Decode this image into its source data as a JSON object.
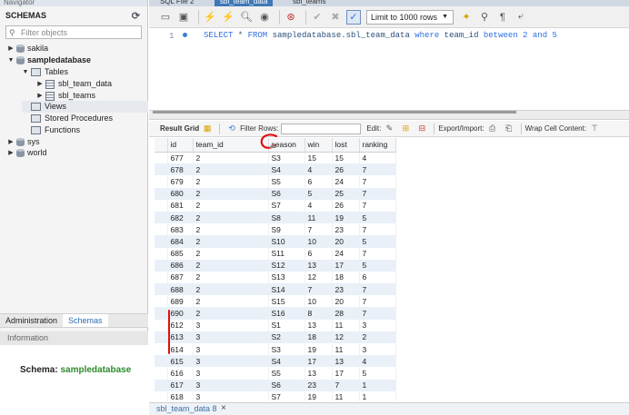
{
  "navigator": {
    "title": "Navigator",
    "schemas_header": "SCHEMAS",
    "filter_placeholder": "Filter objects",
    "tree": {
      "sakila": "sakila",
      "sampledatabase": "sampledatabase",
      "tables": "Tables",
      "table1": "sbl_team_data",
      "table2": "sbl_teams",
      "views": "Views",
      "stored_procedures": "Stored Procedures",
      "functions": "Functions",
      "sys": "sys",
      "world": "world"
    },
    "tabs": {
      "administration": "Administration",
      "schemas": "Schemas"
    },
    "information": "Information",
    "schema_label": "Schema:",
    "schema_value": "sampledatabase"
  },
  "tabstrip": [
    "SQL File 2",
    "sbl_team_data",
    "sbl_teams"
  ],
  "toolbar": {
    "limit": "Limit to 1000 rows"
  },
  "editor": {
    "line": "1",
    "sql": {
      "select": "SELECT",
      "star": " * ",
      "from": "FROM",
      "table": " sampledatabase.sbl_team_data ",
      "where": "where",
      "col": " team_id ",
      "between": "between",
      "a": " 2 ",
      "and": "and",
      "b": " 5"
    }
  },
  "result_toolbar": {
    "result_grid": "Result Grid",
    "filter_rows": "Filter Rows:",
    "edit": "Edit:",
    "export_import": "Export/Import:",
    "wrap": "Wrap Cell Content:"
  },
  "grid": {
    "columns": [
      "id",
      "team_id",
      "season",
      "win",
      "lost",
      "ranking"
    ],
    "rows": [
      [
        "677",
        "2",
        "S3",
        "15",
        "15",
        "4"
      ],
      [
        "678",
        "2",
        "S4",
        "4",
        "26",
        "7"
      ],
      [
        "679",
        "2",
        "S5",
        "6",
        "24",
        "7"
      ],
      [
        "680",
        "2",
        "S6",
        "5",
        "25",
        "7"
      ],
      [
        "681",
        "2",
        "S7",
        "4",
        "26",
        "7"
      ],
      [
        "682",
        "2",
        "S8",
        "11",
        "19",
        "5"
      ],
      [
        "683",
        "2",
        "S9",
        "7",
        "23",
        "7"
      ],
      [
        "684",
        "2",
        "S10",
        "10",
        "20",
        "5"
      ],
      [
        "685",
        "2",
        "S11",
        "6",
        "24",
        "7"
      ],
      [
        "686",
        "2",
        "S12",
        "13",
        "17",
        "5"
      ],
      [
        "687",
        "2",
        "S13",
        "12",
        "18",
        "6"
      ],
      [
        "688",
        "2",
        "S14",
        "7",
        "23",
        "7"
      ],
      [
        "689",
        "2",
        "S15",
        "10",
        "20",
        "7"
      ],
      [
        "690",
        "2",
        "S16",
        "8",
        "28",
        "7"
      ],
      [
        "612",
        "3",
        "S1",
        "13",
        "11",
        "3"
      ],
      [
        "613",
        "3",
        "S2",
        "18",
        "12",
        "2"
      ],
      [
        "614",
        "3",
        "S3",
        "19",
        "11",
        "3"
      ],
      [
        "615",
        "3",
        "S4",
        "17",
        "13",
        "4"
      ],
      [
        "616",
        "3",
        "S5",
        "13",
        "17",
        "5"
      ],
      [
        "617",
        "3",
        "S6",
        "23",
        "7",
        "1"
      ],
      [
        "618",
        "3",
        "S7",
        "19",
        "11",
        "1"
      ]
    ]
  },
  "bottom_tab": {
    "label": "sbl_team_data 8",
    "close": "×"
  },
  "colors": {
    "accent": "#3c7ed6",
    "annotation": "#e01010",
    "schema_value": "#2d8a2d"
  }
}
